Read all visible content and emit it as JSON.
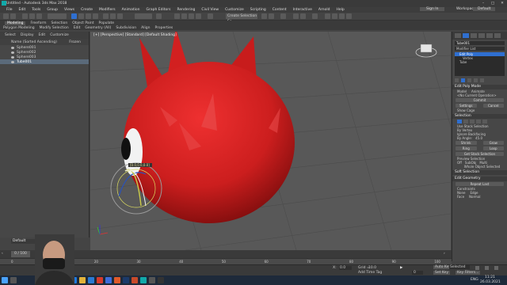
{
  "title": "Untitled - Autodesk 3ds Max 2018",
  "menu": [
    "File",
    "Edit",
    "Tools",
    "Group",
    "Views",
    "Create",
    "Modifiers",
    "Animation",
    "Graph Editors",
    "Rendering",
    "Civil View",
    "Customize",
    "Scripting",
    "Content",
    "Interactive",
    "Arnold",
    "Help"
  ],
  "sign_in": "Sign In",
  "workspaces_label": "Workspaces:",
  "workspace_value": "Default",
  "selection_set": "Create Selection Se",
  "ribbon_tabs": [
    "Modeling",
    "Freeform",
    "Selection",
    "Object Paint",
    "Populate"
  ],
  "ribbon_active": "Modeling",
  "ribbon_sub": [
    "Polygon Modeling",
    "Modify Selection",
    "Edit",
    "Geometry (All)",
    "Subdivision",
    "Align",
    "Properties"
  ],
  "scene_tabs": [
    "Select",
    "Display",
    "Edit",
    "Customize"
  ],
  "scene_header": "Name (Sorted Ascending)",
  "scene_frozen": "Frozen",
  "scene_items": [
    "Sphere001",
    "Sphere002",
    "Sphere003",
    "Tube001"
  ],
  "viewport_label": "[+] [Perspective] [Standard] [Default Shading]",
  "coord_tooltip": "[0.0,0.0,0.0]",
  "right": {
    "object_name": "Tube001",
    "modifier_list": "Modifier List",
    "stack": [
      "Edit Poly",
      "Vertex",
      "Tube"
    ],
    "edit_poly_mode": "Edit Poly Mode",
    "model": "Model",
    "animate": "Animate",
    "no_op": "<No Current Operation>",
    "commit": "Commit",
    "settings": "Settings",
    "cancel": "Cancel",
    "show_cage": "Show Cage",
    "selection": "Selection",
    "use_stack": "Use Stack Selection",
    "by_vertex": "By Vertex",
    "ignore_backfacing": "Ignore Backfacing",
    "by_angle": "By Angle:",
    "angle_val": "45.0",
    "shrink": "Shrink",
    "grow": "Grow",
    "ring": "Ring",
    "loop": "Loop",
    "get_stack": "Get Stack Selection",
    "preview_selection": "Preview Selection",
    "off": "Off",
    "subobj": "SubObj",
    "multi": "Multi",
    "whole_selected": "Whole Object Selected",
    "soft_selection": "Soft Selection",
    "edit_geometry": "Edit Geometry",
    "repeat_last": "Repeat Last",
    "constraints": "Constraints",
    "none": "None",
    "edge": "Edge",
    "face": "Face",
    "normal": "Normal"
  },
  "layer_default": "Default",
  "frame_counter": "0 / 100",
  "ticks": [
    "0",
    "10",
    "20",
    "30",
    "40",
    "50",
    "60",
    "70",
    "80",
    "90",
    "100"
  ],
  "status": {
    "coord_x_label": "X:",
    "coord_x": "0.0",
    "grid_label": "Grid =",
    "grid": "10.0",
    "add_time_tag": "Add Time Tag",
    "auto_key": "Auto Key",
    "selected": "Selected",
    "set_key": "Set Key",
    "key_filters": "Key Filters...",
    "frame": "0"
  },
  "taskbar": {
    "lang": "ENG",
    "time": "11:21",
    "date": "26.03.2021"
  },
  "colors": {
    "accent": "#2f6fd0",
    "object_red": "#cc1e1e",
    "viewport": "#585858"
  }
}
